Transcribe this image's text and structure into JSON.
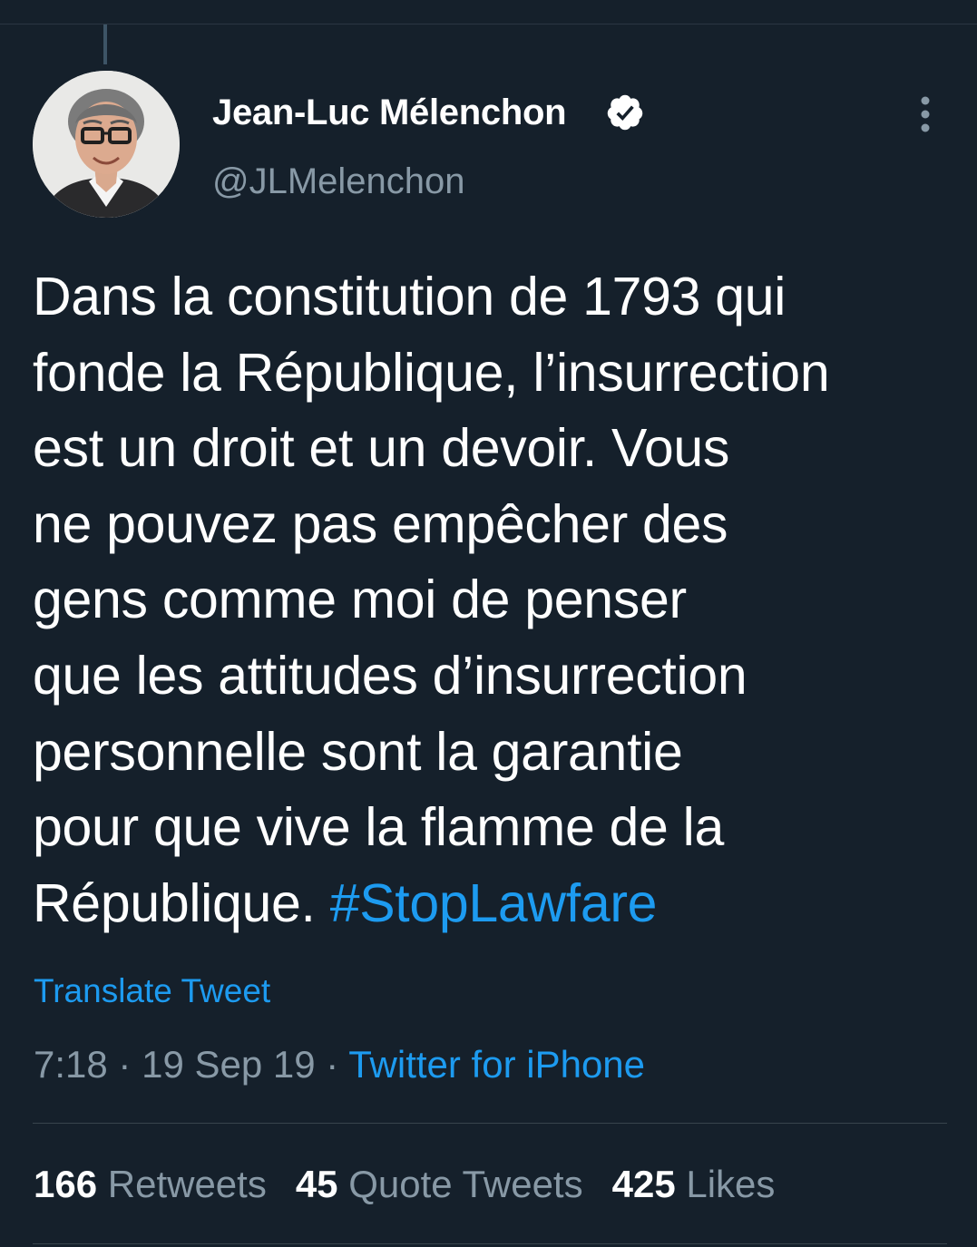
{
  "author": {
    "display_name": "Jean-Luc Mélenchon",
    "handle": "@JLMelenchon",
    "verified": true,
    "avatar_icon": "profile-photo"
  },
  "tweet": {
    "lines": [
      "Dans la constitution de 1793 qui",
      "fonde la République, l’insurrection",
      "est un droit et un devoir. Vous",
      "ne pouvez pas empêcher des",
      "gens comme moi de penser",
      "que les attitudes d’insurrection",
      "personnelle sont la garantie",
      "pour que vive la flamme de la"
    ],
    "last_line_text": "République.",
    "hashtag": "#StopLawfare"
  },
  "translate_label": "Translate Tweet",
  "meta": {
    "time": "7:18",
    "separator": "·",
    "date": "19 Sep 19",
    "source": "Twitter for iPhone"
  },
  "stats": {
    "retweets_count": "166",
    "retweets_label": "Retweets",
    "quotes_count": "45",
    "quotes_label": "Quote Tweets",
    "likes_count": "425",
    "likes_label": "Likes"
  },
  "colors": {
    "background": "#15202b",
    "accent": "#1d9bf0",
    "secondary_text": "#8899a6"
  }
}
